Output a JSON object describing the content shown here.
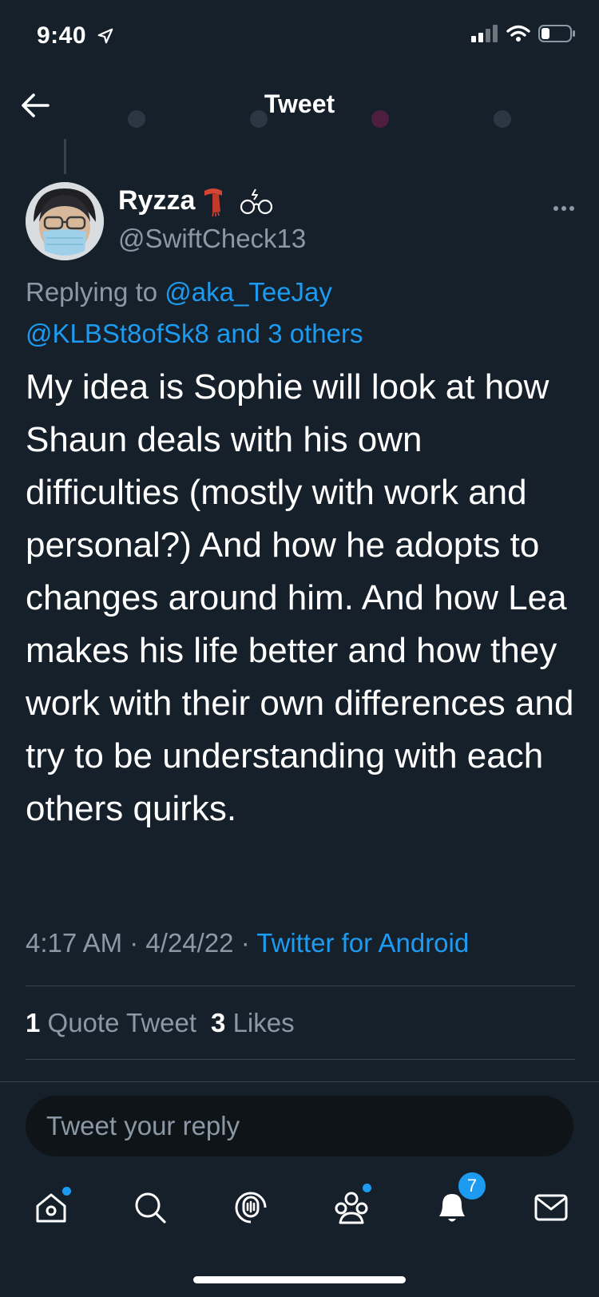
{
  "status_bar": {
    "time": "9:40"
  },
  "header": {
    "title": "Tweet"
  },
  "ghost_text": "",
  "tweet": {
    "display_name": "Ryzza",
    "handle": "@SwiftCheck13",
    "replying_prefix": "Replying to",
    "replying_user1": "@aka_TeeJay",
    "replying_user2": "@KLBSt8ofSk8",
    "replying_and": "and",
    "replying_others": "3 others",
    "body": "My idea is Sophie will look at how Shaun deals with his own difficulties (mostly with work and personal?) And how he adopts to changes around him. And how Lea makes his life better and how they work with their own differences and try to be understanding with each others quirks.",
    "time": "4:17 AM",
    "date": "4/24/22",
    "source": "Twitter for Android",
    "quote_count": "1",
    "quote_label": "Quote Tweet",
    "like_count": "3",
    "like_label": "Likes"
  },
  "reply": {
    "placeholder": "Tweet your reply"
  },
  "tabbar": {
    "notifications_badge": "7"
  },
  "colors": {
    "background": "#15202b",
    "accent": "#1d9bf0",
    "muted": "#8b98a5"
  }
}
